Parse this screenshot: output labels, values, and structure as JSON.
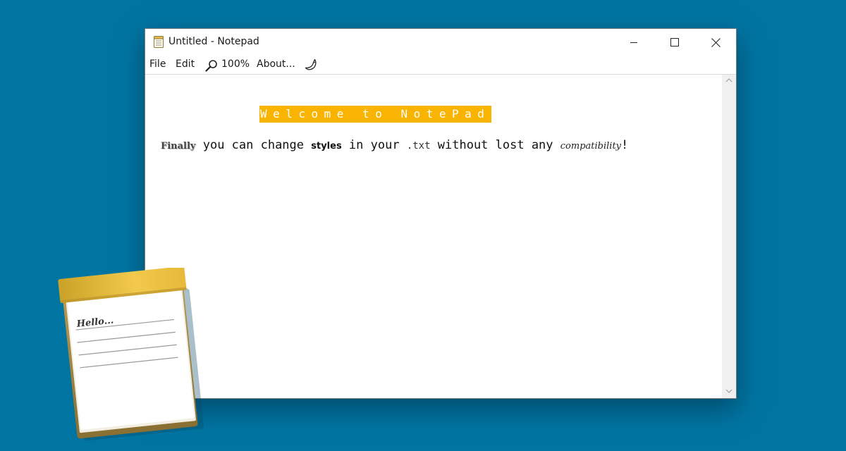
{
  "window": {
    "title": "Untitled - Notepad",
    "controls": {
      "minimize": "minimize",
      "maximize": "maximize",
      "close": "close"
    }
  },
  "menu": {
    "file": "File",
    "edit": "Edit",
    "zoom": "100%",
    "about": "About...",
    "zoom_icon": "magnifier-icon",
    "theme_icon": "moon-icon"
  },
  "document": {
    "heading": "Welcome to NotePad",
    "heading_bg": "#f8b400",
    "line": {
      "finally": "Finally",
      "part1": " you can change ",
      "styles": "styles",
      "part2": " in your ",
      "txt": ".txt",
      "part3": " without lost any ",
      "compatibility": "compatibility",
      "end": "!"
    }
  },
  "illustration": {
    "handwriting": "Hello..."
  },
  "colors": {
    "desktop": "#0075a2",
    "accent": "#f8b400",
    "pad_header": "#f2c94c"
  }
}
